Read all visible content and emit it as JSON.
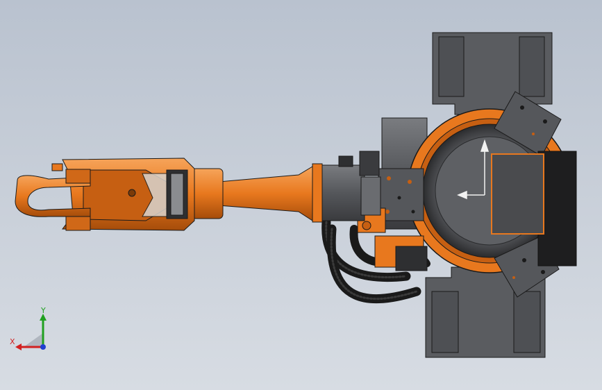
{
  "viewport": {
    "background_top": "#b9c2cf",
    "background_bottom": "#d7dce3"
  },
  "colors": {
    "orange": "#e8781e",
    "orange_dark": "#a54c0a",
    "orange_light": "#f6a45a",
    "gray_plate": "#5a5c60",
    "gray_dark": "#3a3b3e",
    "black": "#1a1a1a",
    "axis_x": "#d22020",
    "axis_y": "#20a020",
    "axis_z": "#2040d0"
  },
  "triad": {
    "x_label": "X",
    "y_label": "Y"
  }
}
